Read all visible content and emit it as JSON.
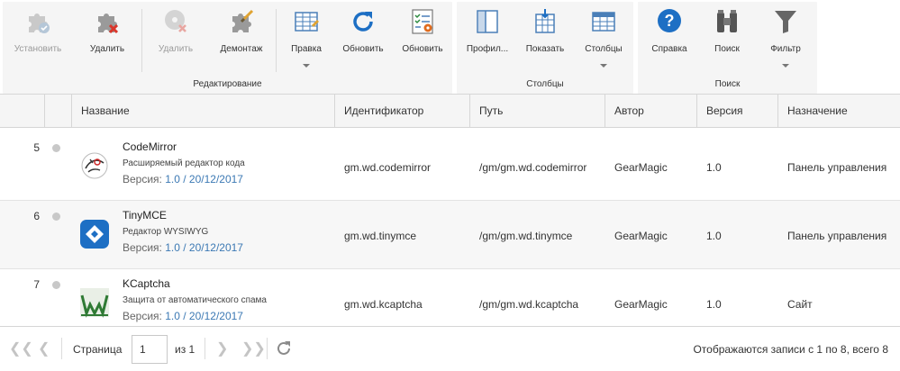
{
  "ribbon": {
    "groups": [
      {
        "caption": "Редактирование",
        "buttons": [
          {
            "label": "Установить",
            "icon": "puzzle-install-icon",
            "disabled": true
          },
          {
            "label": "Удалить",
            "icon": "puzzle-delete-icon",
            "disabled": false
          },
          {
            "label": "Удалить",
            "icon": "disk-delete-icon",
            "disabled": true
          },
          {
            "label": "Демонтаж",
            "icon": "puzzle-dismount-icon",
            "disabled": false
          },
          {
            "label": "Правка",
            "icon": "grid-edit-icon",
            "disabled": false,
            "dropdown": true
          },
          {
            "label": "Обновить",
            "icon": "refresh-icon",
            "disabled": false
          },
          {
            "label": "Обновить",
            "icon": "checklist-gear-icon",
            "disabled": false
          }
        ]
      },
      {
        "caption": "Столбцы",
        "buttons": [
          {
            "label": "Профил...",
            "icon": "profile-columns-icon"
          },
          {
            "label": "Показать",
            "icon": "show-columns-icon"
          },
          {
            "label": "Столбцы",
            "icon": "columns-icon",
            "dropdown": true
          }
        ]
      },
      {
        "caption": "Поиск",
        "buttons": [
          {
            "label": "Справка",
            "icon": "help-icon"
          },
          {
            "label": "Поиск",
            "icon": "binoculars-icon"
          },
          {
            "label": "Фильтр",
            "icon": "filter-icon",
            "dropdown": true
          }
        ]
      }
    ]
  },
  "grid": {
    "columns": [
      "Название",
      "Идентификатор",
      "Путь",
      "Автор",
      "Версия",
      "Назначение"
    ],
    "rows": [
      {
        "num": "5",
        "logo": "codemirror-logo",
        "name": "CodeMirror",
        "description": "Расширяемый редактор кода",
        "version_prefix": "Версия:",
        "version_link": "1.0 / 20/12/2017",
        "id": "gm.wd.codemirror",
        "path": "/gm/gm.wd.codemirror",
        "author": "GearMagic",
        "version": "1.0",
        "purpose": "Панель управления"
      },
      {
        "num": "6",
        "logo": "tinymce-logo",
        "name": "TinyMCE",
        "description": "Редактор WYSIWYG",
        "version_prefix": "Версия:",
        "version_link": "1.0 / 20/12/2017",
        "id": "gm.wd.tinymce",
        "path": "/gm/gm.wd.tinymce",
        "author": "GearMagic",
        "version": "1.0",
        "purpose": "Панель управления"
      },
      {
        "num": "7",
        "logo": "kcaptcha-logo",
        "name": "KCaptcha",
        "description": "Защита от автоматического спама",
        "version_prefix": "Версия:",
        "version_link": "1.0 / 20/12/2017",
        "id": "gm.wd.kcaptcha",
        "path": "/gm/gm.wd.kcaptcha",
        "author": "GearMagic",
        "version": "1.0",
        "purpose": "Сайт"
      }
    ]
  },
  "pager": {
    "page_label": "Страница",
    "page_value": "1",
    "of_label": "из 1",
    "summary": "Отображаются записи с 1 по 8, всего 8"
  },
  "colors": {
    "link": "#3c79b4",
    "accent_blue": "#1d6fc4",
    "delete_red": "#d9362b"
  }
}
